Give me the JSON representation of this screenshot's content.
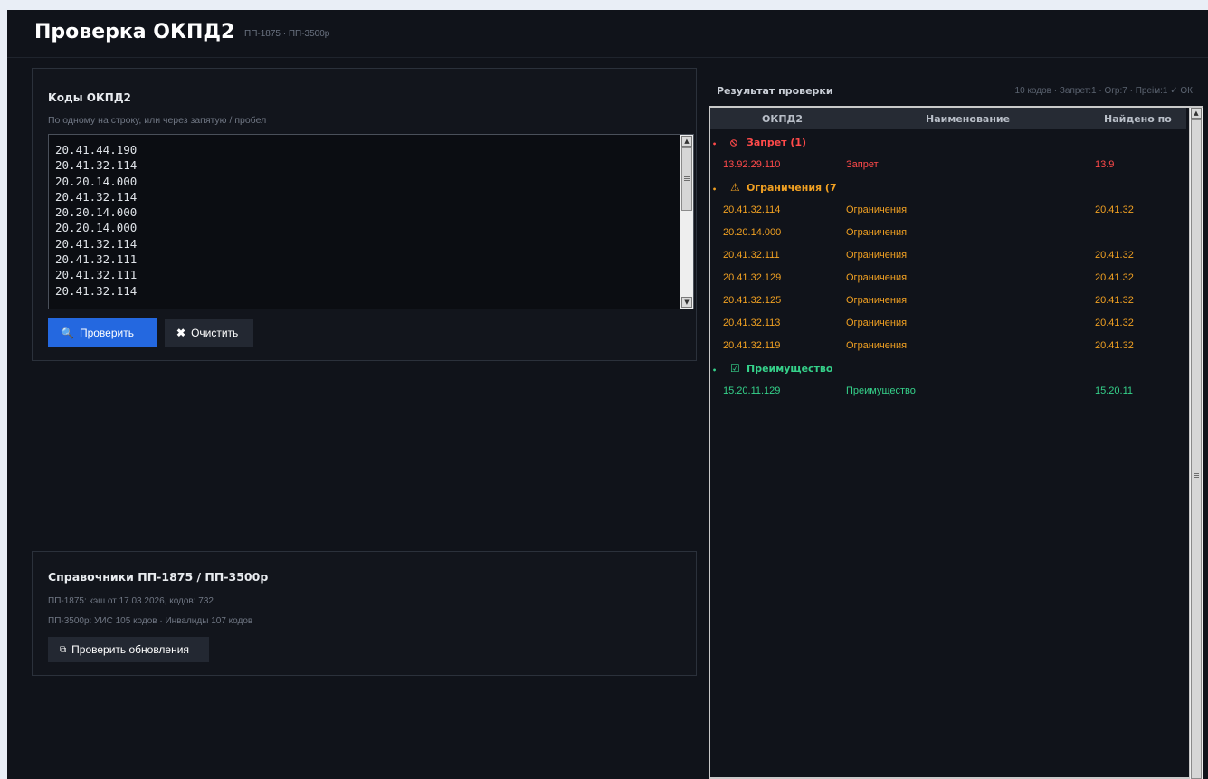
{
  "header": {
    "title": "Проверка ОКПД2",
    "subtitle": "ПП-1875 · ПП-3500р"
  },
  "input_panel": {
    "title": "Коды ОКПД2",
    "hint": "По одному на строку, или через запятую / пробел",
    "codes": "20.41.44.190\n20.41.32.114\n20.20.14.000\n20.41.32.114\n20.20.14.000\n20.20.14.000\n20.41.32.114\n20.41.32.111\n20.41.32.111\n20.41.32.114",
    "check_label": "Проверить",
    "clear_label": "Очистить"
  },
  "dict_panel": {
    "title": "Справочники ПП-1875 / ПП-3500р",
    "line1": "ПП-1875: кэш от 17.03.2026, кодов: 732",
    "line2": "ПП-3500р: УИС 105 кодов · Инвалиды 107 кодов",
    "update_label": "Проверить обновления"
  },
  "results": {
    "title": "Результат проверки",
    "stats": "10 кодов · Запрет:1 · Огр:7 · Преім:1 ✓ ОК",
    "columns": [
      "ОКПД2",
      "Наименование",
      "Найдено по"
    ],
    "groups": [
      {
        "label": "Запрет (1)",
        "icon": "ban-icon",
        "color": "#ff4a4a",
        "rows": [
          {
            "code": "13.92.29.110",
            "name": "Запрет",
            "found": "13.9"
          }
        ]
      },
      {
        "label": "Ограничения (7",
        "icon": "warning-icon",
        "color": "#f0a022",
        "rows": [
          {
            "code": "20.41.32.114",
            "name": "Ограничения",
            "found": "20.41.32"
          },
          {
            "code": "20.20.14.000",
            "name": "Ограничения",
            "found": ""
          },
          {
            "code": "20.41.32.111",
            "name": "Ограничения",
            "found": "20.41.32"
          },
          {
            "code": "20.41.32.129",
            "name": "Ограничения",
            "found": "20.41.32"
          },
          {
            "code": "20.41.32.125",
            "name": "Ограничения",
            "found": "20.41.32"
          },
          {
            "code": "20.41.32.113",
            "name": "Ограничения",
            "found": "20.41.32"
          },
          {
            "code": "20.41.32.119",
            "name": "Ограничения",
            "found": "20.41.32"
          }
        ]
      },
      {
        "label": "Преимущество",
        "icon": "checkbox-icon",
        "color": "#35d18a",
        "rows": [
          {
            "code": "15.20.11.129",
            "name": "Преимущество",
            "found": "15.20.11"
          }
        ]
      }
    ]
  },
  "colors": {
    "background": "#10131a",
    "accent": "#2468e0",
    "danger": "#ff4a4a",
    "warning": "#f0a022",
    "success": "#35d18a"
  }
}
